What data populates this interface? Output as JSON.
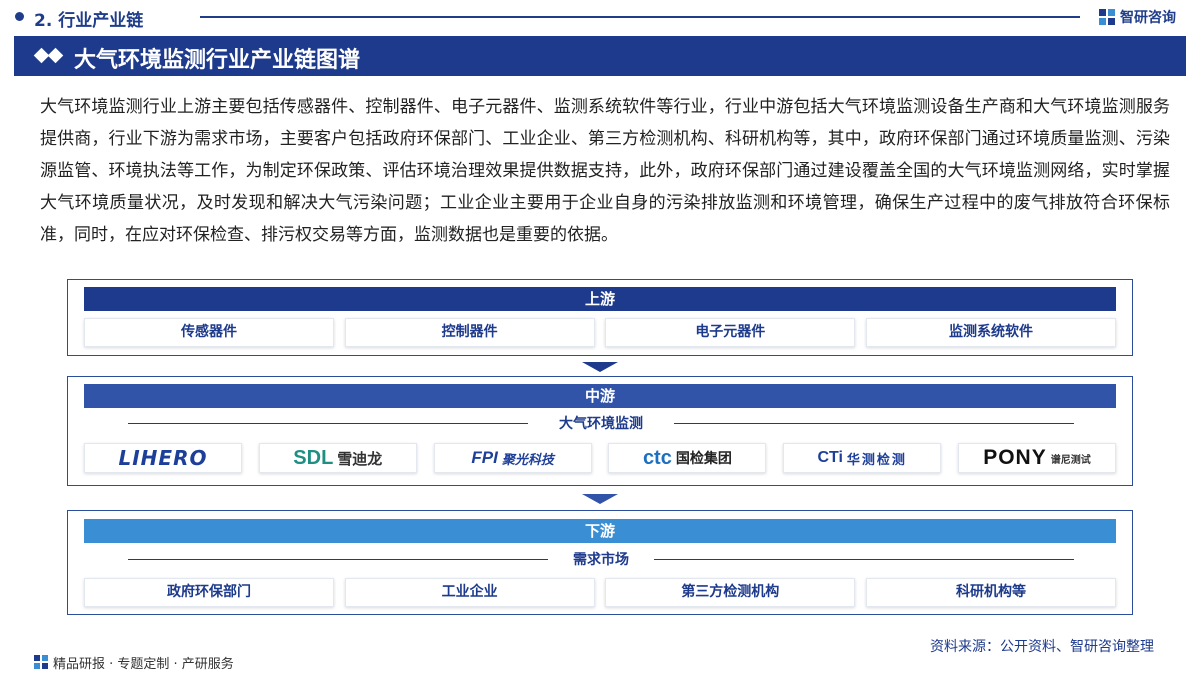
{
  "header": {
    "section": "2. 行业产业链",
    "brand": "智研咨询",
    "title": "大气环境监测行业产业链图谱"
  },
  "description": "大气环境监测行业上游主要包括传感器件、控制器件、电子元器件、监测系统软件等行业，行业中游包括大气环境监测设备生产商和大气环境监测服务提供商，行业下游为需求市场，主要客户包括政府环保部门、工业企业、第三方检测机构、科研机构等，其中，政府环保部门通过环境质量监测、污染源监管、环境执法等工作，为制定环保政策、评估环境治理效果提供数据支持，此外，政府环保部门通过建设覆盖全国的大气环境监测网络，实时掌握大气环境质量状况，及时发现和解决大气污染问题；工业企业主要用于企业自身的污染排放监测和环境管理，确保生产过程中的废气排放符合环保标准，同时，在应对环保检查、排污权交易等方面，监测数据也是重要的依据。",
  "upstream": {
    "title": "上游",
    "items": [
      "传感器件",
      "控制器件",
      "电子元器件",
      "监测系统软件"
    ]
  },
  "midstream": {
    "title": "中游",
    "subtitle": "大气环境监测",
    "logos": [
      {
        "mark": "LIHERO"
      },
      {
        "mark": "SDL",
        "cn": "雪迪龙"
      },
      {
        "mark": "FPI",
        "cn": "聚光科技"
      },
      {
        "mark": "ctc",
        "cn": "国检集团"
      },
      {
        "mark": "CTi",
        "cn": "华测检测"
      },
      {
        "mark": "PONY",
        "cn": "谱尼测试"
      }
    ]
  },
  "downstream": {
    "title": "下游",
    "subtitle": "需求市场",
    "items": [
      "政府环保部门",
      "工业企业",
      "第三方检测机构",
      "科研机构等"
    ]
  },
  "footer": {
    "source": "资料来源：公开资料、智研咨询整理",
    "slogan": "精品研报 · 专题定制 · 产研服务"
  },
  "colors": {
    "navy": "#1d3a8c",
    "mid_blue": "#3154a8",
    "light_blue": "#3a8fd4"
  }
}
